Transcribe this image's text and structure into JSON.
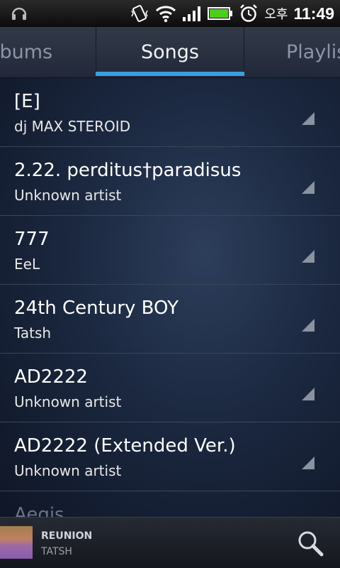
{
  "status_bar": {
    "ampm": "오후",
    "time": "11:49",
    "icons": [
      "headphones-icon",
      "vibrate-icon",
      "wifi-icon",
      "signal-icon",
      "battery-icon",
      "alarm-icon"
    ]
  },
  "tabs": [
    {
      "label": "lbums"
    },
    {
      "label": "Songs"
    },
    {
      "label": "Playlis"
    }
  ],
  "songs": [
    {
      "title": "[E]",
      "artist": "dj MAX STEROID"
    },
    {
      "title": "2.22. perditus†paradisus",
      "artist": "Unknown artist"
    },
    {
      "title": "777",
      "artist": "EeL"
    },
    {
      "title": "24th Century BOY",
      "artist": "Tatsh"
    },
    {
      "title": "AD2222",
      "artist": "Unknown artist"
    },
    {
      "title": "AD2222 (Extended Ver.)",
      "artist": "Unknown artist"
    },
    {
      "title": "Aegis",
      "artist": ""
    }
  ],
  "now_playing": {
    "title": "REUNION",
    "artist": "TATSH"
  },
  "colors": {
    "accent": "#3a9fdc",
    "battery": "#4ccf1a"
  }
}
